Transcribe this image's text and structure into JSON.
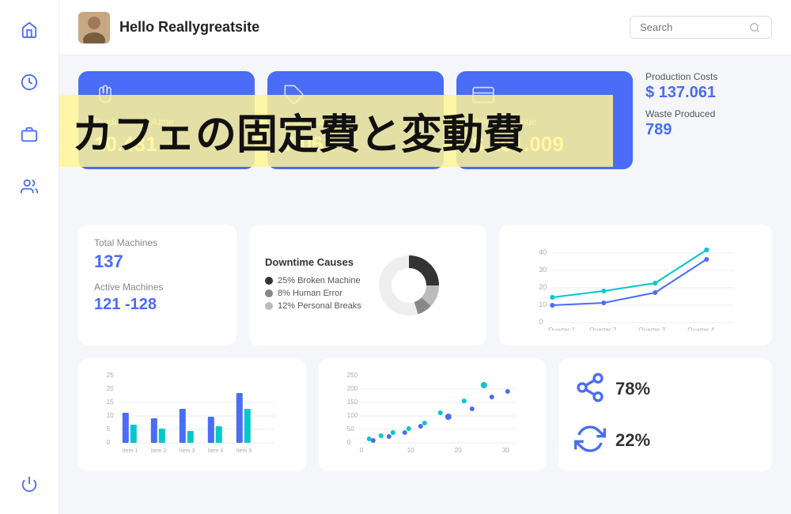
{
  "header": {
    "title": "Hello Reallygreatsite",
    "search_placeholder": "Search"
  },
  "sidebar": {
    "icons": [
      "home",
      "dashboard",
      "briefcase",
      "users",
      "power"
    ]
  },
  "cards": [
    {
      "label": "Production Volume",
      "value": "10.431",
      "icon": "hands"
    },
    {
      "label": "Order Volume",
      "value": "7.061",
      "icon": "tag"
    },
    {
      "label": "Sales Revenue",
      "value": "$ 291.009",
      "icon": "money"
    }
  ],
  "side_stats": {
    "production_costs_label": "Production Costs",
    "production_costs_value": "$ 137.061",
    "waste_produced_label": "Waste Produced",
    "waste_produced_value": "789"
  },
  "machines": {
    "total_label": "Total Machines",
    "total_value": "137",
    "active_label": "Active Machines",
    "active_value": "121 -128"
  },
  "donut": {
    "title": "Downtime Causes",
    "legend": [
      {
        "label": "25% Broken Machine",
        "color": "#333"
      },
      {
        "label": "8% Human Error",
        "color": "#888"
      },
      {
        "label": "12% Personal Breaks",
        "color": "#bbb"
      }
    ]
  },
  "line_chart": {
    "quarters": [
      "Quarter 1",
      "Quarter 2",
      "Quarter 3",
      "Quarter 4"
    ],
    "y_labels": [
      "0",
      "10",
      "20",
      "30",
      "40"
    ]
  },
  "bar_chart": {
    "items": [
      "Item 1",
      "Item 2",
      "Item 3",
      "Item 4",
      "Item 5"
    ],
    "y_labels": [
      "0",
      "5",
      "10",
      "15",
      "20",
      "25"
    ]
  },
  "scatter_chart": {
    "x_labels": [
      "0",
      "10",
      "20",
      "30"
    ],
    "y_labels": [
      "0",
      "50",
      "100",
      "150",
      "200",
      "250"
    ]
  },
  "kpis": [
    {
      "value": "78%",
      "icon": "share"
    },
    {
      "value": "22%",
      "icon": "refresh"
    }
  ],
  "overlay": {
    "text": "カフェの固定費と変動費"
  }
}
